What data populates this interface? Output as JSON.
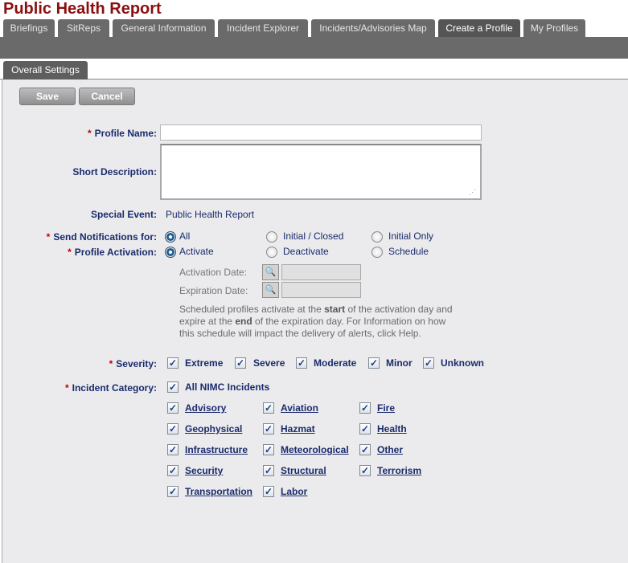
{
  "app": {
    "title": "Public Health Report"
  },
  "tabs": [
    {
      "label": "Briefings"
    },
    {
      "label": "SitReps"
    },
    {
      "label": "General Information"
    },
    {
      "label": "Incident Explorer"
    },
    {
      "label": "Incidents/Advisories Map"
    },
    {
      "label": "Create a Profile",
      "active": true
    },
    {
      "label": "My Profiles"
    }
  ],
  "subtabs": [
    {
      "label": "Overall Settings",
      "active": true
    }
  ],
  "toolbar": {
    "save_label": "Save",
    "cancel_label": "Cancel"
  },
  "form": {
    "profile_name": {
      "label": "Profile Name:",
      "required": "*",
      "value": ""
    },
    "short_description": {
      "label": "Short Description:",
      "value": ""
    },
    "special_event": {
      "label": "Special Event:",
      "value": "Public Health Report"
    },
    "send_notifications": {
      "label": "Send Notifications for:",
      "required": "*",
      "options": [
        "All",
        "Initial / Closed",
        "Initial Only"
      ],
      "selected": "All"
    },
    "profile_activation": {
      "label": "Profile Activation:",
      "required": "*",
      "options": [
        "Activate",
        "Deactivate",
        "Schedule"
      ],
      "selected": "Activate"
    },
    "activation_date": {
      "label": "Activation Date:",
      "value": ""
    },
    "expiration_date": {
      "label": "Expiration Date:",
      "value": ""
    },
    "schedule_help": {
      "t1": "Scheduled profiles activate at the ",
      "b1": "start",
      "t2": " of the activation day and expire at the ",
      "b2": "end",
      "t3": " of the expiration day. For Information on how this schedule will impact the delivery of alerts, click Help."
    },
    "severity": {
      "label": "Severity:",
      "required": "*",
      "options": [
        {
          "label": "Extreme",
          "checked": true
        },
        {
          "label": "Severe",
          "checked": true
        },
        {
          "label": "Moderate",
          "checked": true
        },
        {
          "label": "Minor",
          "checked": true
        },
        {
          "label": "Unknown",
          "checked": true
        }
      ]
    },
    "incident_category": {
      "label": "Incident Category:",
      "required": "*",
      "all_label": "All NIMC Incidents",
      "all_checked": true,
      "options": [
        {
          "label": "Advisory",
          "checked": true
        },
        {
          "label": "Aviation",
          "checked": true
        },
        {
          "label": "Fire",
          "checked": true
        },
        {
          "label": "Geophysical",
          "checked": true
        },
        {
          "label": "Hazmat",
          "checked": true
        },
        {
          "label": "Health",
          "checked": true
        },
        {
          "label": "Infrastructure",
          "checked": true
        },
        {
          "label": "Meteorological",
          "checked": true
        },
        {
          "label": "Other",
          "checked": true
        },
        {
          "label": "Security",
          "checked": true
        },
        {
          "label": "Structural",
          "checked": true
        },
        {
          "label": "Terrorism",
          "checked": true
        },
        {
          "label": "Transportation",
          "checked": true
        },
        {
          "label": "Labor",
          "checked": true
        }
      ]
    }
  },
  "icons": {
    "check": "✓",
    "calendar": "🔍",
    "grip": "⋰"
  }
}
